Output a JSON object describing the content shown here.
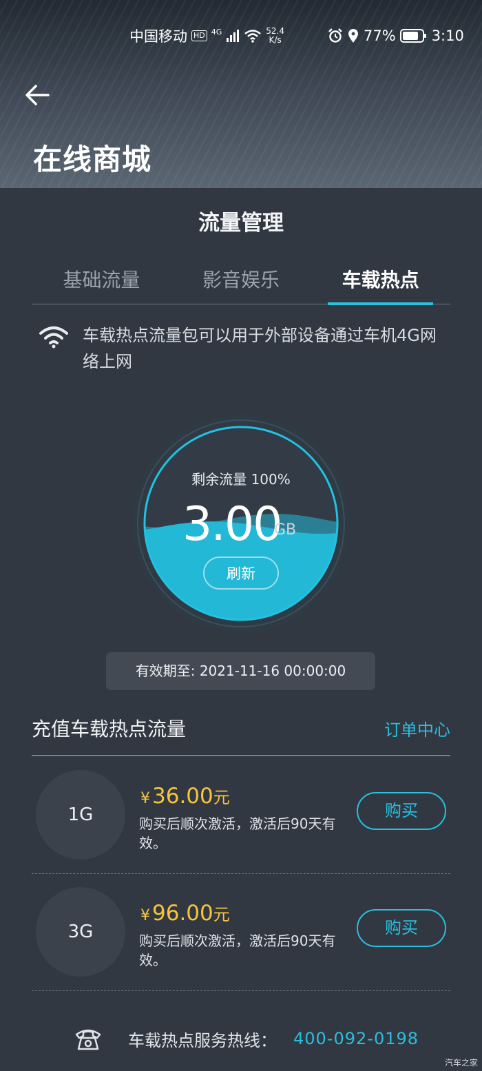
{
  "status_bar": {
    "carrier": "中国移动",
    "hd": "HD",
    "network": "4G",
    "speed_value": "52.4",
    "speed_unit": "K/s",
    "battery": "77%",
    "time": "3:10"
  },
  "header": {
    "title": "在线商城"
  },
  "section": {
    "title": "流量管理"
  },
  "tabs": [
    {
      "label": "基础流量",
      "active": false
    },
    {
      "label": "影音娱乐",
      "active": false
    },
    {
      "label": "车载热点",
      "active": true
    }
  ],
  "note": {
    "text": "车载热点流量包可以用于外部设备通过车机4G网络上网"
  },
  "gauge": {
    "remaining_label": "剩余流量 100%",
    "value": "3.00",
    "unit": "GB",
    "fill_fraction": 0.5,
    "refresh_label": "刷新"
  },
  "expiry": {
    "text": "有效期至: 2021-11-16 00:00:00"
  },
  "recharge": {
    "title": "充值车载热点流量",
    "order_center": "订单中心"
  },
  "packages": [
    {
      "size": "1G",
      "yen": "¥",
      "price": "36.00",
      "unit": "元",
      "desc": "购买后顺次激活，激活后90天有效。",
      "buy_label": "购买"
    },
    {
      "size": "3G",
      "yen": "¥",
      "price": "96.00",
      "unit": "元",
      "desc": "购买后顺次激活，激活后90天有效。",
      "buy_label": "购买"
    }
  ],
  "hotline": {
    "label": "车载热点服务热线：",
    "number": "400-092-0198"
  },
  "watermark": "汽车之家",
  "colors": {
    "accent": "#27c0e0",
    "price": "#f7c43c",
    "background": "#323842"
  }
}
